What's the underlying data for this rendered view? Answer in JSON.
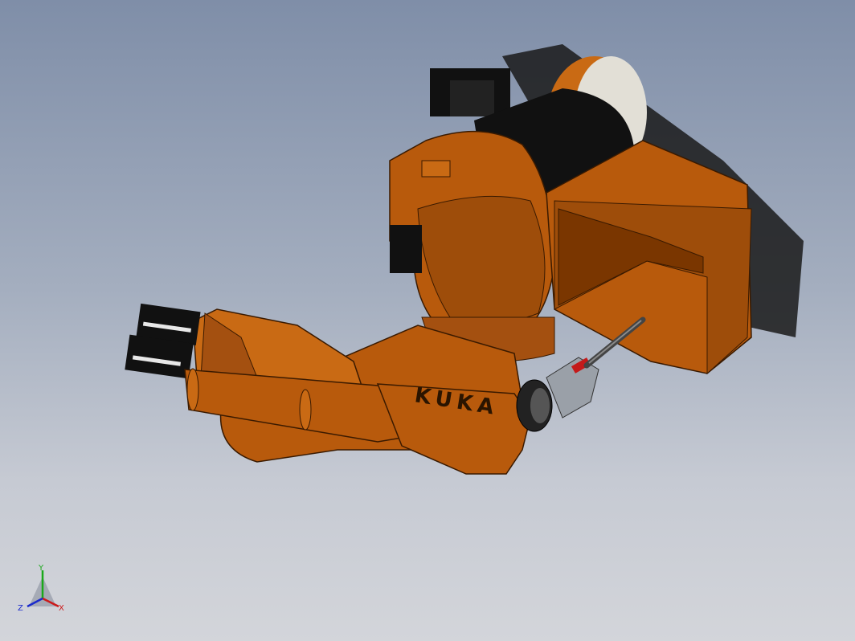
{
  "viewport": {
    "background_top": "#7f8ea8",
    "background_bottom": "#d3d5da"
  },
  "model": {
    "brand_text": "KUKA",
    "body_color": "#b85a0c",
    "shade_color": "#7a3600",
    "black_color": "#111111"
  },
  "triad": {
    "x_label": "X",
    "y_label": "Y",
    "z_label": "Z",
    "x_color": "#cc1a1a",
    "y_color": "#1aa81a",
    "z_color": "#1a2acc"
  }
}
